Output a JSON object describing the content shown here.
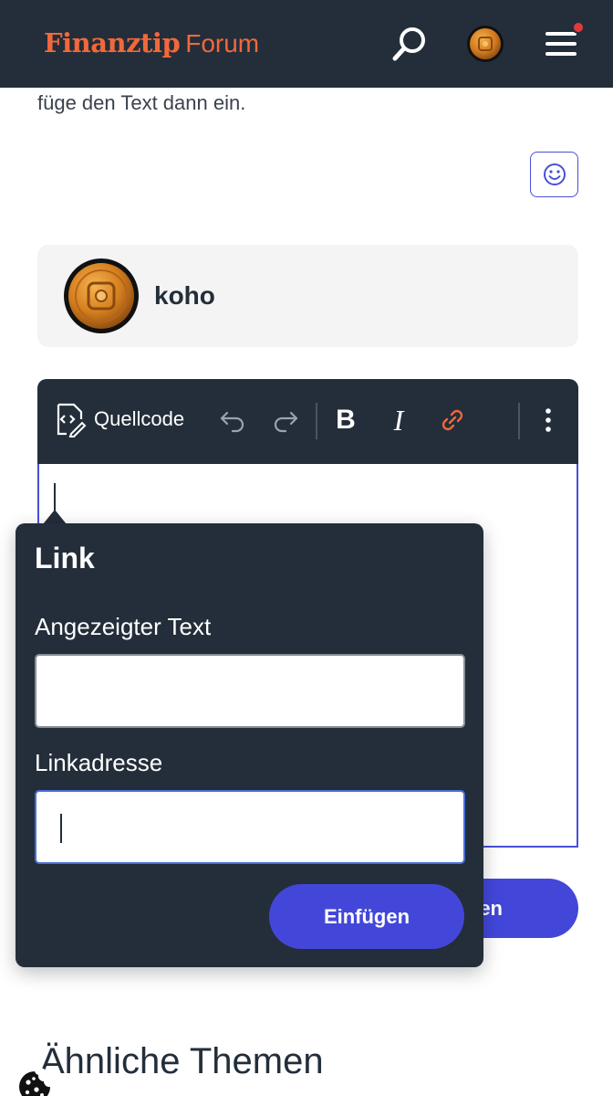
{
  "header": {
    "brand_main": "Finanztip",
    "brand_sub": "Forum",
    "search_icon": "search-icon",
    "menu_icon": "hamburger-menu-icon",
    "has_notification_dot": true,
    "accent_color": "#f2683a",
    "background": "#232e3a"
  },
  "content": {
    "intro_text": "füge den Text dann ein.",
    "emoji_icon": "smiley-icon"
  },
  "user_card": {
    "name": "koho"
  },
  "editor": {
    "toolbar": {
      "source_label": "Quellcode",
      "undo_icon": "undo-icon",
      "redo_icon": "redo-icon",
      "bold_label": "B",
      "italic_label": "I",
      "link_icon": "link-icon",
      "more_icon": "more-vertical-icon"
    },
    "submit_label_partial": "en"
  },
  "link_popup": {
    "title": "Link",
    "display_text_label": "Angezeigter Text",
    "display_text_value": "",
    "url_label": "Linkadresse",
    "url_value": "",
    "insert_label": "Einfügen"
  },
  "footer": {
    "similar_title": "Ähnliche Themen",
    "cookie_icon": "cookie-icon"
  },
  "colors": {
    "primary": "#4347d9",
    "dark": "#232e3a"
  }
}
